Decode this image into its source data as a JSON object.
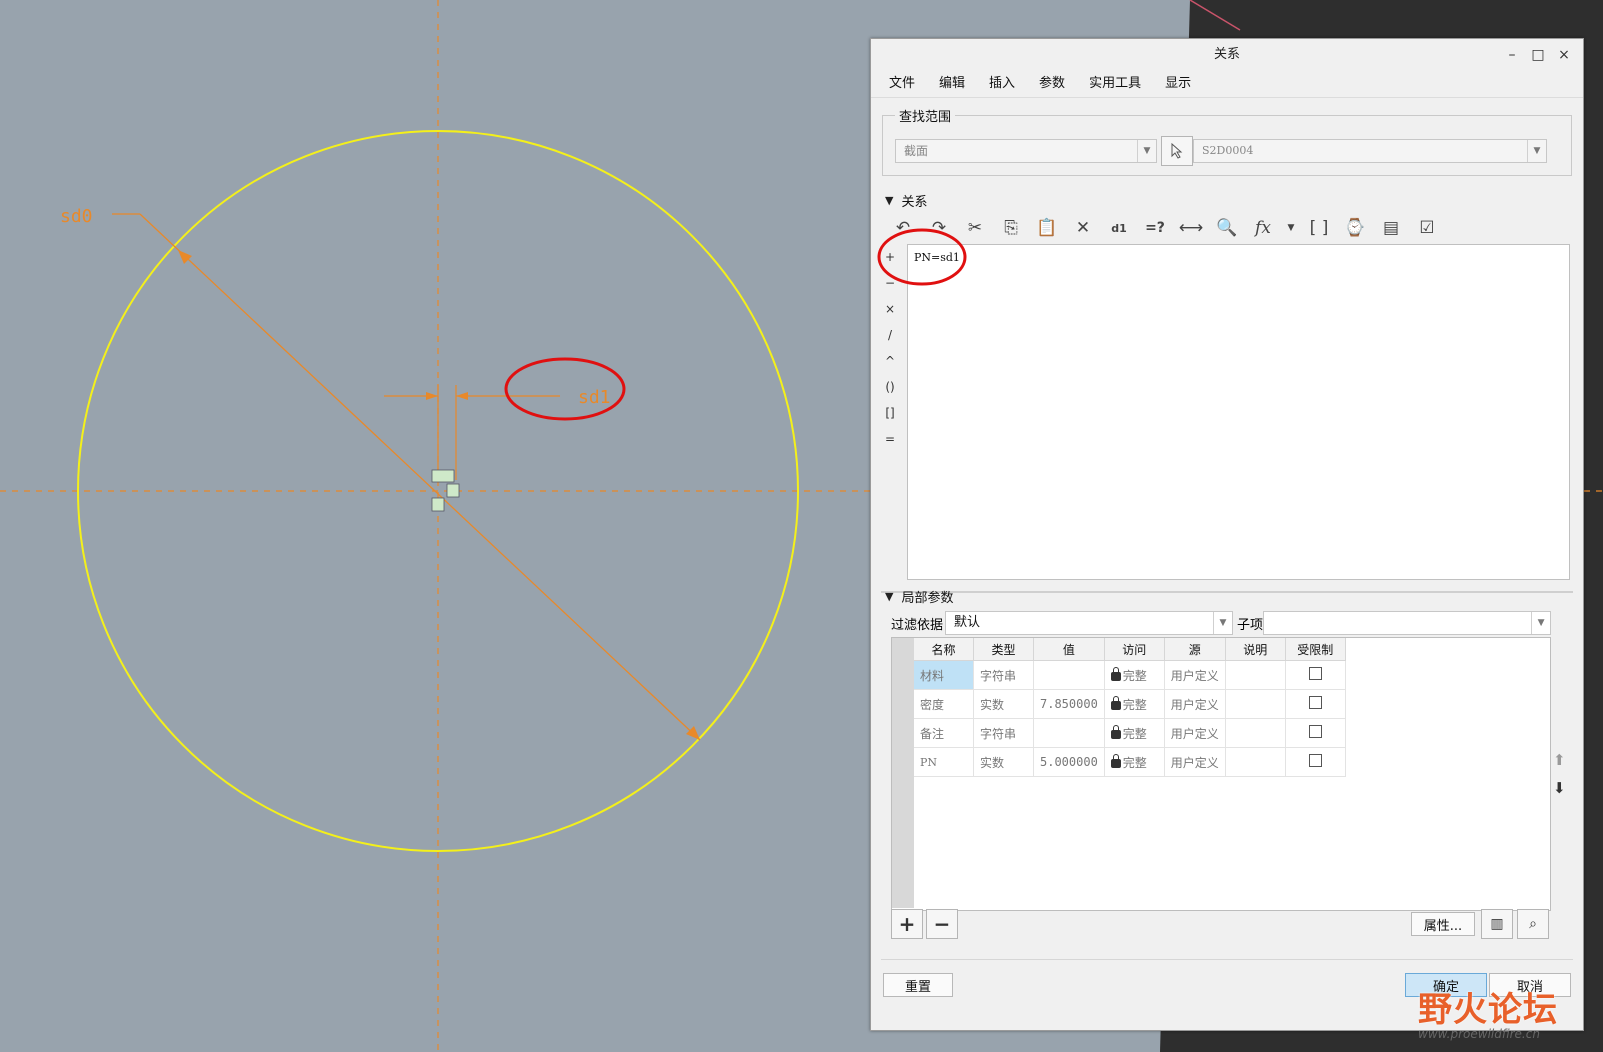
{
  "window": {
    "title": "关系",
    "minimize": "–",
    "maximize": "□",
    "close": "×"
  },
  "menu": [
    "文件",
    "编辑",
    "插入",
    "参数",
    "实用工具",
    "显示"
  ],
  "scope": {
    "legend": "查找范围",
    "combo1_value": "截面",
    "combo2_value": "S2D0004"
  },
  "relations": {
    "header": "关系",
    "operators": [
      "+",
      "−",
      "×",
      "/",
      "^",
      "()",
      "[]",
      "="
    ],
    "text": "PN=sd1"
  },
  "local_params": {
    "header": "局部参数",
    "filter_label": "过滤依据",
    "filter_value": "默认",
    "subitem_label": "子项",
    "columns": [
      "名称",
      "类型",
      "值",
      "访问",
      "源",
      "说明",
      "受限制"
    ],
    "rows": [
      {
        "name": "材料",
        "type": "字符串",
        "value": "",
        "access": "完整",
        "source": "用户定义",
        "desc": ""
      },
      {
        "name": "密度",
        "type": "实数",
        "value": "7.850000",
        "access": "完整",
        "source": "用户定义",
        "desc": ""
      },
      {
        "name": "备注",
        "type": "字符串",
        "value": "",
        "access": "完整",
        "source": "用户定义",
        "desc": ""
      },
      {
        "name": "PN",
        "type": "实数",
        "value": "5.000000",
        "access": "完整",
        "source": "用户定义",
        "desc": ""
      }
    ],
    "properties_btn": "属性..."
  },
  "footer": {
    "reset": "重置",
    "ok": "确定",
    "cancel": "取消"
  },
  "sketch": {
    "dim_sd0": "sd0",
    "dim_sd1": "sd1",
    "circle_color": "#f4f01a",
    "dim_color": "#e8892a",
    "highlight_color": "#e01010"
  },
  "watermark": {
    "text": "野火论坛",
    "url": "www.proewildfire.cn"
  }
}
